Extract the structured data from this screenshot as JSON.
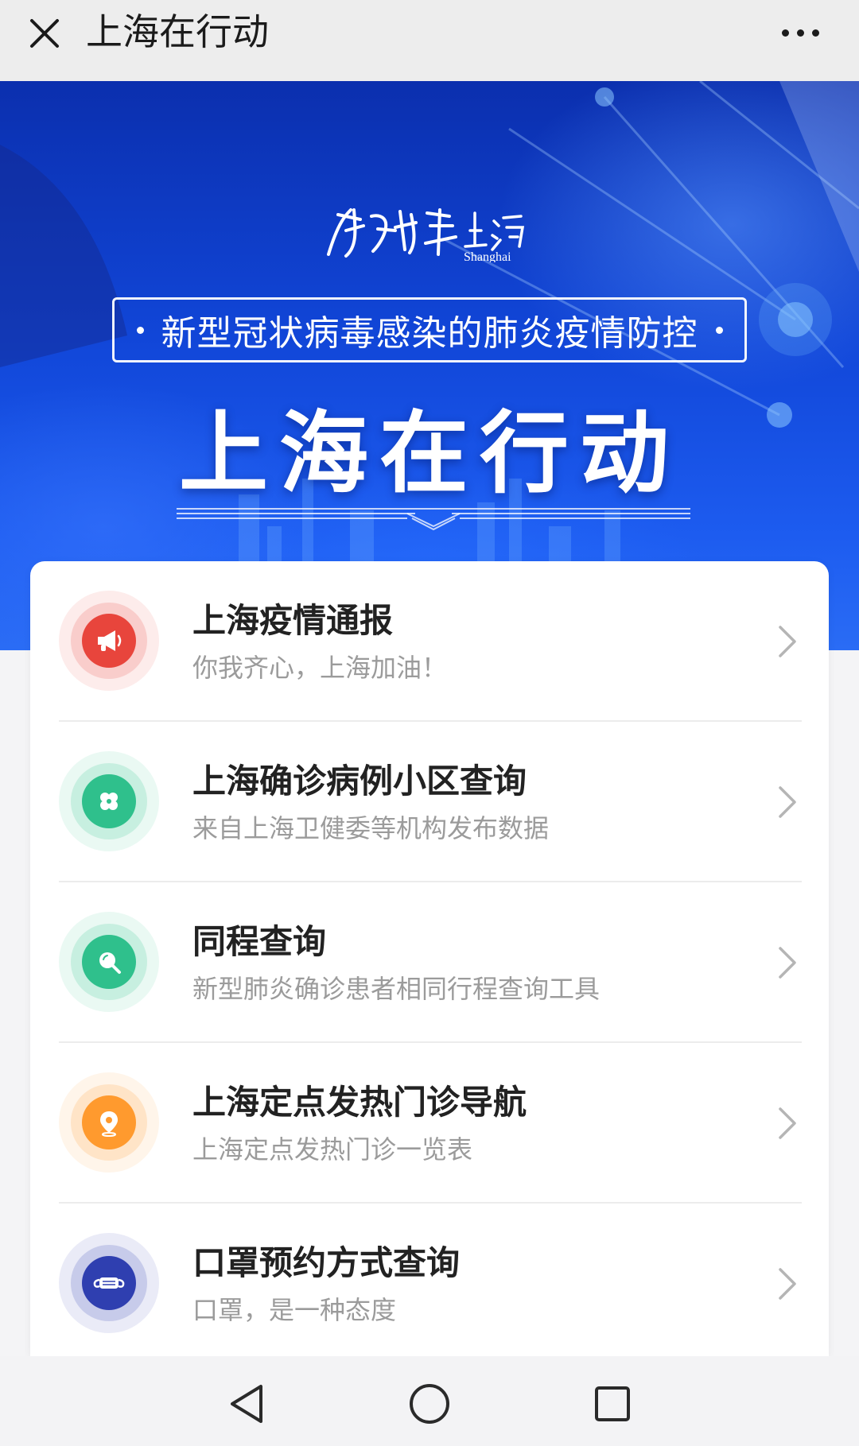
{
  "window": {
    "title": "上海在行动"
  },
  "banner": {
    "brand_text": "Shanghai",
    "subtitle": "新型冠状病毒感染的肺炎疫情防控",
    "title": "上海在行动"
  },
  "services": [
    {
      "title": "上海疫情通报",
      "subtitle": "你我齐心，上海加油！",
      "icon": "megaphone-icon",
      "color": "#e8453c"
    },
    {
      "title": "上海确诊病例小区查询",
      "subtitle": "来自上海卫健委等机构发布数据",
      "icon": "clover-icon",
      "color": "#2fc08c"
    },
    {
      "title": "同程查询",
      "subtitle": "新型肺炎确诊患者相同行程查询工具",
      "icon": "search-icon",
      "color": "#2fc08c"
    },
    {
      "title": "上海定点发热门诊导航",
      "subtitle": "上海定点发热门诊一览表",
      "icon": "location-pin-icon",
      "color": "#ff9a2e"
    },
    {
      "title": "口罩预约方式查询",
      "subtitle": "口罩，是一种态度",
      "icon": "mask-icon",
      "color": "#2f3fb0"
    }
  ],
  "navbar": {
    "back": "back-triangle-icon",
    "home": "home-circle-icon",
    "recent": "recent-square-icon"
  }
}
